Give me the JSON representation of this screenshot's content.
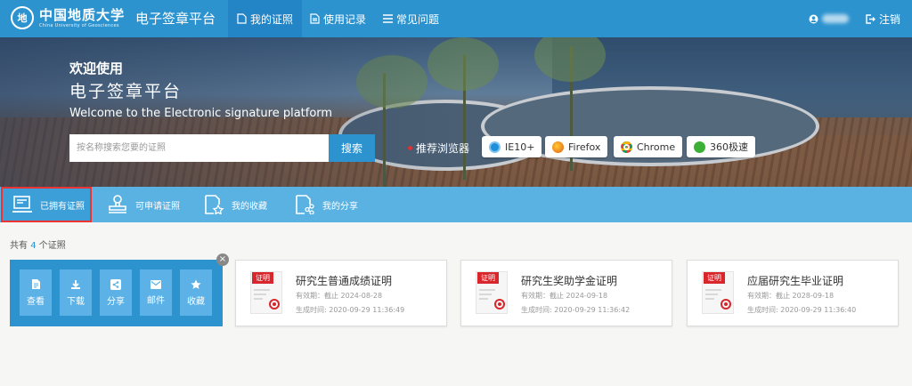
{
  "header": {
    "logo_cn": "中国地质大学",
    "logo_en": "China University of Geosciences",
    "separator": "·",
    "app_title": "电子签章平台",
    "tabs": [
      {
        "label": "我的证照",
        "icon": "certificate-icon",
        "active": true
      },
      {
        "label": "使用记录",
        "icon": "record-icon",
        "active": false
      },
      {
        "label": "常见问题",
        "icon": "list-icon",
        "active": false
      }
    ],
    "user_icon": "user-icon",
    "logout_label": "注销"
  },
  "banner": {
    "welcome": "欢迎使用",
    "platform": "电子签章平台",
    "welcome_en": "Welcome  to the Electronic signature platform",
    "search_placeholder": "按名称搜索您要的证照",
    "search_button": "搜索",
    "recommend_label": "推荐浏览器",
    "browsers": [
      {
        "label": "IE10+",
        "icon": "ie-icon"
      },
      {
        "label": "Firefox",
        "icon": "firefox-icon"
      },
      {
        "label": "Chrome",
        "icon": "chrome-icon"
      },
      {
        "label": "360极速",
        "icon": "360-browser-icon"
      }
    ]
  },
  "subtabs": [
    {
      "label": "已拥有证照",
      "icon": "owned-certificate-icon",
      "active": true
    },
    {
      "label": "可申请证照",
      "icon": "stamp-icon",
      "active": false
    },
    {
      "label": "我的收藏",
      "icon": "favorite-document-icon",
      "active": false
    },
    {
      "label": "我的分享",
      "icon": "share-document-icon",
      "active": false
    }
  ],
  "summary": {
    "prefix": "共有",
    "count": "4",
    "suffix": "个证照"
  },
  "actions": [
    {
      "label": "查看",
      "icon": "view-icon"
    },
    {
      "label": "下载",
      "icon": "download-icon"
    },
    {
      "label": "分享",
      "icon": "share-icon"
    },
    {
      "label": "邮件",
      "icon": "mail-icon"
    },
    {
      "label": "收藏",
      "icon": "star-icon"
    }
  ],
  "close_label": "×",
  "certificates": [
    {
      "tag": "证明",
      "name": "研究生普通成绩证明",
      "valid": "有效期：截止 2024-08-28",
      "created": "生成时间: 2020-09-29 11:36:49"
    },
    {
      "tag": "证明",
      "name": "研究生奖助学金证明",
      "valid": "有效期：截止 2024-09-18",
      "created": "生成时间: 2020-09-29 11:36:42"
    },
    {
      "tag": "证明",
      "name": "应届研究生毕业证明",
      "valid": "有效期：截止 2028-09-18",
      "created": "生成时间: 2020-09-29 11:36:40"
    }
  ],
  "colors": {
    "primary": "#2d93cf",
    "subbar": "#5ab2e3",
    "accent_red": "#d7262c"
  }
}
